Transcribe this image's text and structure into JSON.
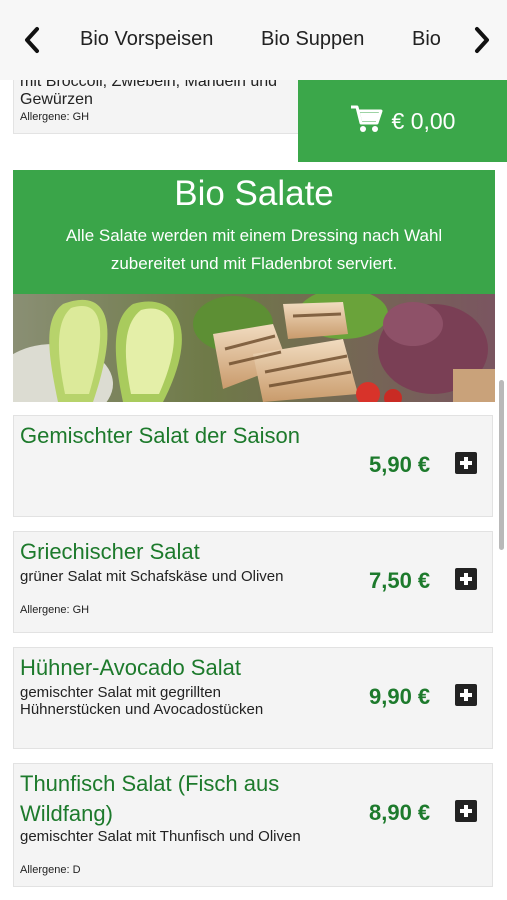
{
  "nav": {
    "tabs": [
      "Bio Vorspeisen",
      "Bio Suppen",
      "Bio"
    ]
  },
  "previous_item": {
    "line1": "mit Broccoli, Zwiebeln, Mandeln und",
    "line2": "Gewürzen",
    "allergen": "Allergene: GH"
  },
  "cart": {
    "total": "€ 0,00"
  },
  "category": {
    "title": "Bio Salate",
    "description": "Alle Salate werden mit einem Dressing nach Wahl zubereitet und mit Fladenbrot serviert."
  },
  "items": [
    {
      "name": "Gemischter Salat der Saison",
      "description": "",
      "allergen": "",
      "price": "5,90 €"
    },
    {
      "name": "Griechischer Salat",
      "description": "grüner Salat mit Schafskäse und Oliven",
      "allergen": "Allergene: GH",
      "price": "7,50 €"
    },
    {
      "name": "Hühner-Avocado Salat",
      "description": "gemischter Salat mit gegrillten Hühnerstücken und Avocadostücken",
      "allergen": "",
      "price": "9,90 €"
    },
    {
      "name": "Thunfisch Salat (Fisch aus Wildfang)",
      "description": "gemischter Salat mit Thunfisch und Oliven",
      "allergen": "Allergene: D",
      "price": "8,90 €"
    }
  ],
  "colors": {
    "brand_green": "#3aa549",
    "price_green": "#1d7a2c",
    "card_bg": "#f4f4f4"
  },
  "icons": {
    "nav_prev": "chevron-left-icon",
    "nav_next": "chevron-right-icon",
    "cart": "shopping-cart-icon",
    "add": "plus-square-icon"
  }
}
